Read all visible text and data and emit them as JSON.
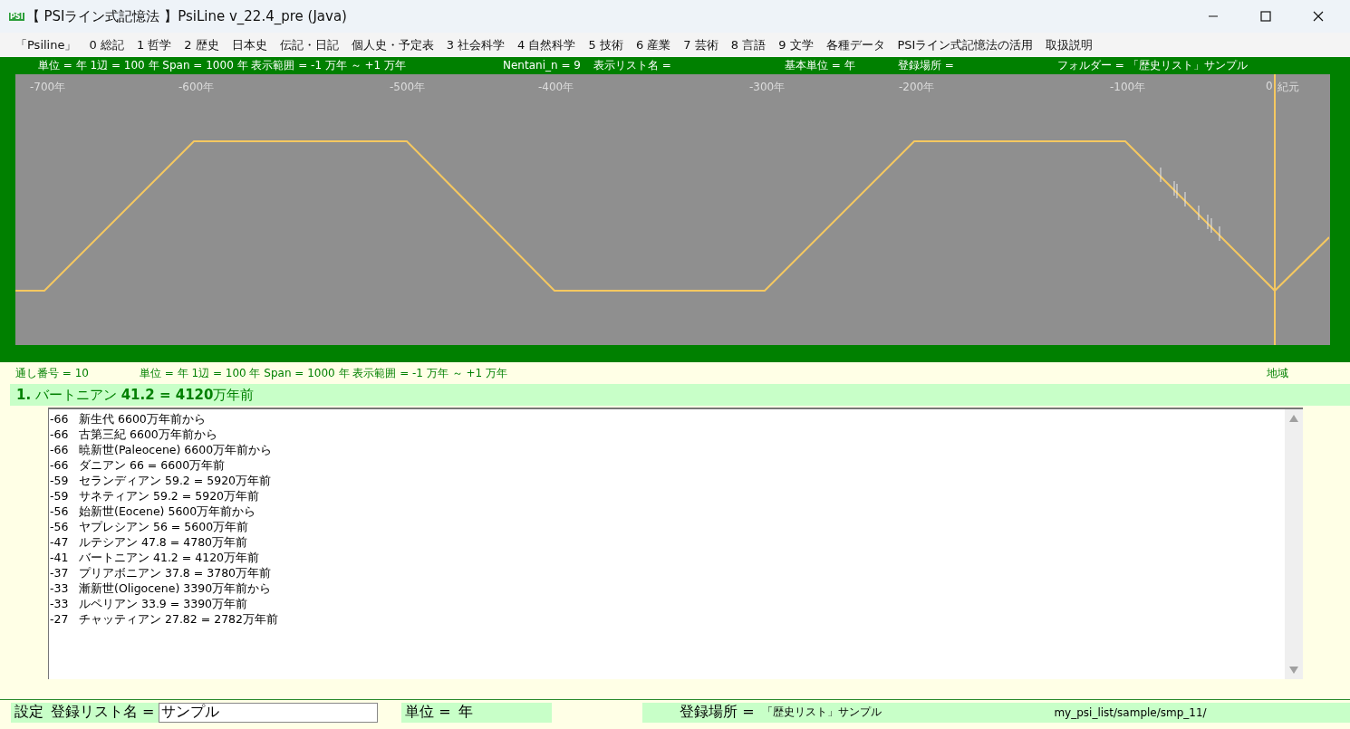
{
  "window": {
    "title": "【 PSIライン式記憶法 】PsiLine v_22.4_pre (Java)",
    "app_icon": "PSI"
  },
  "menu": [
    "「Psiline」",
    "0 総記",
    "1 哲学",
    "2 歴史",
    "日本史",
    "伝記・日記",
    "個人史・予定表",
    "3 社会科学",
    "4 自然科学",
    "5 技術",
    "6 産業",
    "7 芸術",
    "8 言語",
    "9 文学",
    "各種データ",
    "PSIライン式記憶法の活用",
    "取扱説明"
  ],
  "timeline_info": [
    "単位 = 年  1辺 = 100 年  Span = 1000 年  表示範囲 = -1 万年 ～ +1 万年",
    "Nentani_n = 9",
    "表示リスト名 =",
    "基本単位 = 年",
    "登録場所 =",
    "フォルダー = 「歴史リスト」サンプル"
  ],
  "timeline_labels": [
    "-700年",
    "-600年",
    "-500年",
    "-400年",
    "-300年",
    "-200年",
    "-100年",
    "0",
    "紀元"
  ],
  "status_info": {
    "serial": "通し番号 = 10",
    "scale": "単位 = 年  1辺 = 100 年  Span = 1000 年  表示範囲 = -1 万年 ～ +1 万年",
    "region": "地域"
  },
  "current_entry": "**1.** バートニアン **41.2 = 4120**万年前",
  "list_lines": [
    {
      "year": "-66",
      "text": "新生代 6600万年前から"
    },
    {
      "year": "-66",
      "text": "古第三紀 6600万年前から"
    },
    {
      "year": "-66",
      "text": "暁新世(Paleocene) 6600万年前から"
    },
    {
      "year": "-66",
      "text": "ダニアン 66 = 6600万年前"
    },
    {
      "year": "-59",
      "text": "セランディアン 59.2 = 5920万年前"
    },
    {
      "year": "-59",
      "text": "サネティアン 59.2 = 5920万年前"
    },
    {
      "year": "-56",
      "text": "始新世(Eocene) 5600万年前から"
    },
    {
      "year": "-56",
      "text": "ヤプレシアン 56 = 5600万年前"
    },
    {
      "year": "-47",
      "text": "ルテシアン 47.8 = 4780万年前"
    },
    {
      "year": "-41",
      "text": "バートニアン 41.2 = 4120万年前"
    },
    {
      "year": "-37",
      "text": "プリアボニアン 37.8 = 3780万年前"
    },
    {
      "year": "-33",
      "text": "漸新世(Oligocene) 3390万年前から"
    },
    {
      "year": "-33",
      "text": "ルペリアン 33.9 = 3390万年前"
    },
    {
      "year": "-27",
      "text": "チャッティアン 27.82 = 2782万年前"
    }
  ],
  "footer": {
    "settings": "設定",
    "list_name_label": "登録リスト名 =",
    "list_name_value": "サンプル",
    "unit_label": "単位 =",
    "unit_value": "年",
    "location_label": "登録場所 =",
    "location_value": "「歴史リスト」サンプル",
    "path": "my_psi_list/sample/smp_11/"
  }
}
